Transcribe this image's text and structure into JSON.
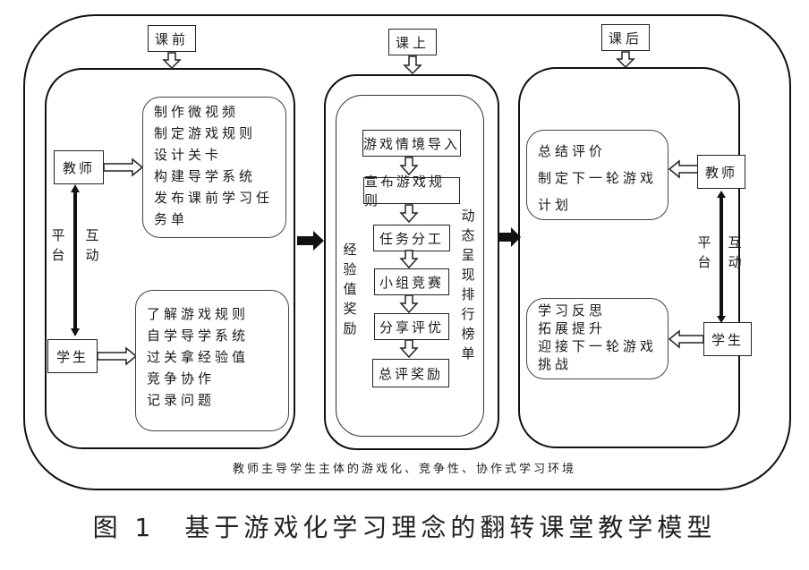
{
  "stages": {
    "pre": {
      "label": "课前",
      "teacher": "教师",
      "student": "学生",
      "interaction_left": "平台",
      "interaction_right": "互动",
      "teacher_tasks": [
        "制作微视频",
        "制定游戏规则",
        "设计关卡",
        "构建导学系统",
        "发布课前学习任",
        "务单"
      ],
      "student_tasks": [
        "了解游戏规则",
        "自学导学系统",
        "过关拿经验值",
        "竞争协作",
        "记录问题"
      ]
    },
    "in": {
      "label": "课上",
      "flow_steps": [
        "游戏情境导入",
        "宣布游戏规则",
        "任务分工",
        "小组竞赛",
        "分享评优",
        "总评奖励"
      ],
      "left_side_text": "经验值奖励",
      "right_side_text": "动态呈现排行榜单"
    },
    "post": {
      "label": "课后",
      "teacher": "教师",
      "student": "学生",
      "interaction_left": "平台",
      "interaction_right": "互动",
      "teacher_tasks": [
        "总结评价",
        "制定下一轮游戏",
        "计划"
      ],
      "student_tasks": [
        "学习反思",
        "拓展提升",
        "迎接下一轮游戏",
        "挑战"
      ]
    }
  },
  "environment_text": "教师主导学生主体的游戏化、竞争性、协作式学习环境",
  "caption": "图 1　基于游戏化学习理念的翻转课堂教学模型"
}
